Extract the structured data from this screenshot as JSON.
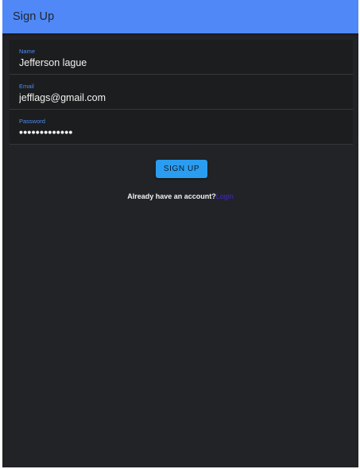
{
  "appbar": {
    "title": "Sign Up"
  },
  "form": {
    "name": {
      "label": "Name",
      "value": "Jefferson lague"
    },
    "email": {
      "label": "Email",
      "value": "jefflags@gmail.com"
    },
    "password": {
      "label": "Password",
      "value": "•••••••••••••"
    }
  },
  "signup_button": {
    "label": "SIGN UP"
  },
  "account_prompt": {
    "text": "Already have an account?",
    "link_label": "Login"
  },
  "colors": {
    "appbar": "#5089f7",
    "background": "#212327",
    "field_label": "#4a8cf7",
    "button": "#2b9df1",
    "link": "#3d2cc7"
  }
}
